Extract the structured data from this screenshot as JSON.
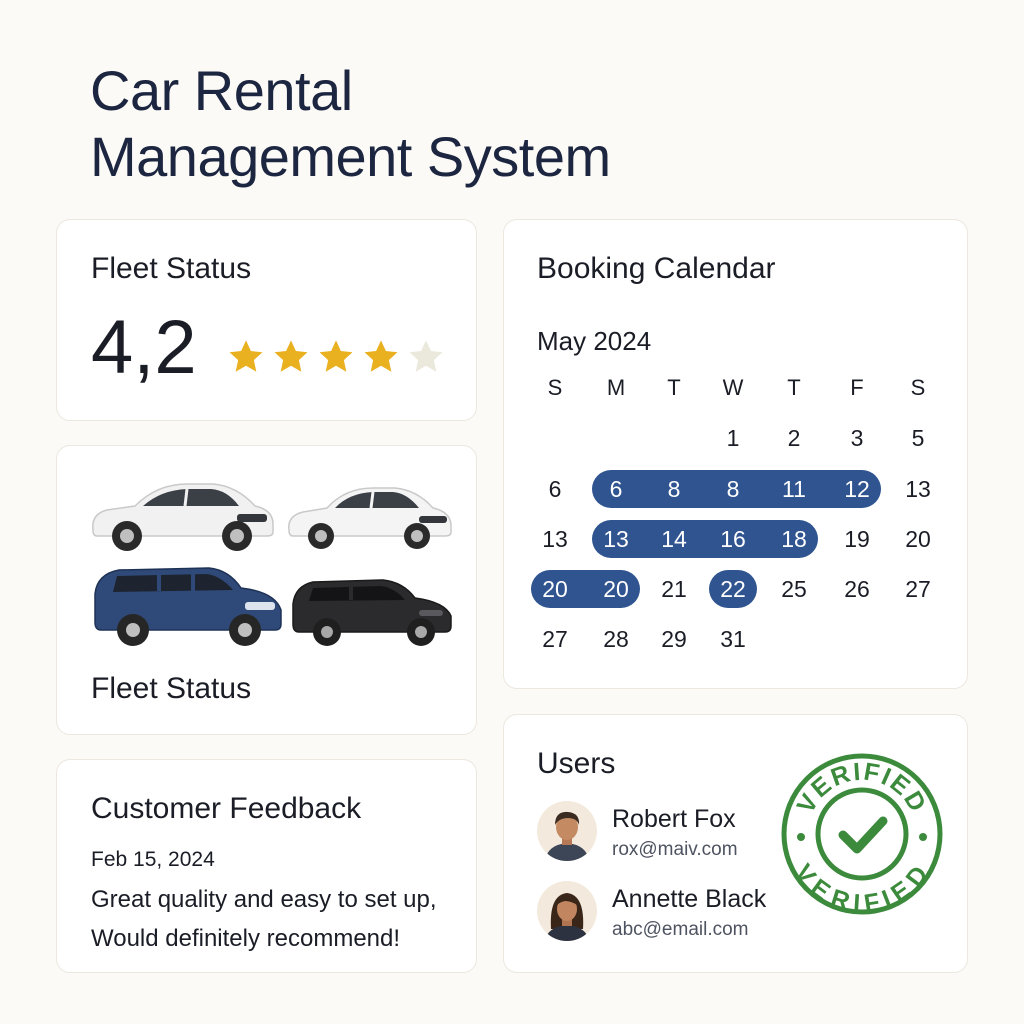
{
  "header": {
    "title_line1": "Car Rental",
    "title_line2": "Management System"
  },
  "rating_card": {
    "title": "Fleet Status",
    "value": "4,2",
    "stars_filled": 4,
    "stars_total": 5,
    "star_color": "#e9b020",
    "star_empty_color": "#ebe8dc"
  },
  "fleet_card": {
    "title": "Fleet Status",
    "cars": [
      {
        "icon": "white-sedan-icon",
        "color": "#f2f2f2"
      },
      {
        "icon": "white-sedan-icon",
        "color": "#f2f2f2"
      },
      {
        "icon": "blue-suv-icon",
        "color": "#2f4a78"
      },
      {
        "icon": "black-suv-icon",
        "color": "#2a2a2c"
      }
    ]
  },
  "feedback_card": {
    "title": "Customer Feedback",
    "date": "Feb 15, 2024",
    "text_line1": "Great quality and easy to set up,",
    "text_line2": "Would definitely recommend!"
  },
  "calendar_card": {
    "title": "Booking Calendar",
    "month": "May 2024",
    "weekdays": [
      "S",
      "M",
      "T",
      "W",
      "T",
      "F",
      "S"
    ],
    "weeks": [
      [
        "",
        "",
        "",
        "1",
        "2",
        "3",
        "5"
      ],
      [
        "6",
        "6",
        "8",
        "8",
        "11",
        "12",
        "13"
      ],
      [
        "13",
        "13",
        "14",
        "16",
        "18",
        "19",
        "20"
      ],
      [
        "20",
        "20",
        "21",
        "22",
        "25",
        "26",
        "27"
      ],
      [
        "27",
        "28",
        "29",
        "31",
        "",
        "",
        ""
      ]
    ],
    "selected_ranges": [
      {
        "week": 1,
        "from": 1,
        "to": 5
      },
      {
        "week": 2,
        "from": 1,
        "to": 4
      },
      {
        "week": 3,
        "from": 0,
        "to": 1
      },
      {
        "week": 3,
        "from": 3,
        "to": 3
      }
    ],
    "highlight_color": "#2f5490"
  },
  "users_card": {
    "title": "Users",
    "users": [
      {
        "name": "Robert Fox",
        "email": "rox@maiv.com",
        "avatar": "male-avatar-icon"
      },
      {
        "name": "Annette Black",
        "email": "abc@email.com",
        "avatar": "female-avatar-icon"
      }
    ],
    "stamp_text": "VERIFIED",
    "stamp_color": "#3c8a3c"
  }
}
